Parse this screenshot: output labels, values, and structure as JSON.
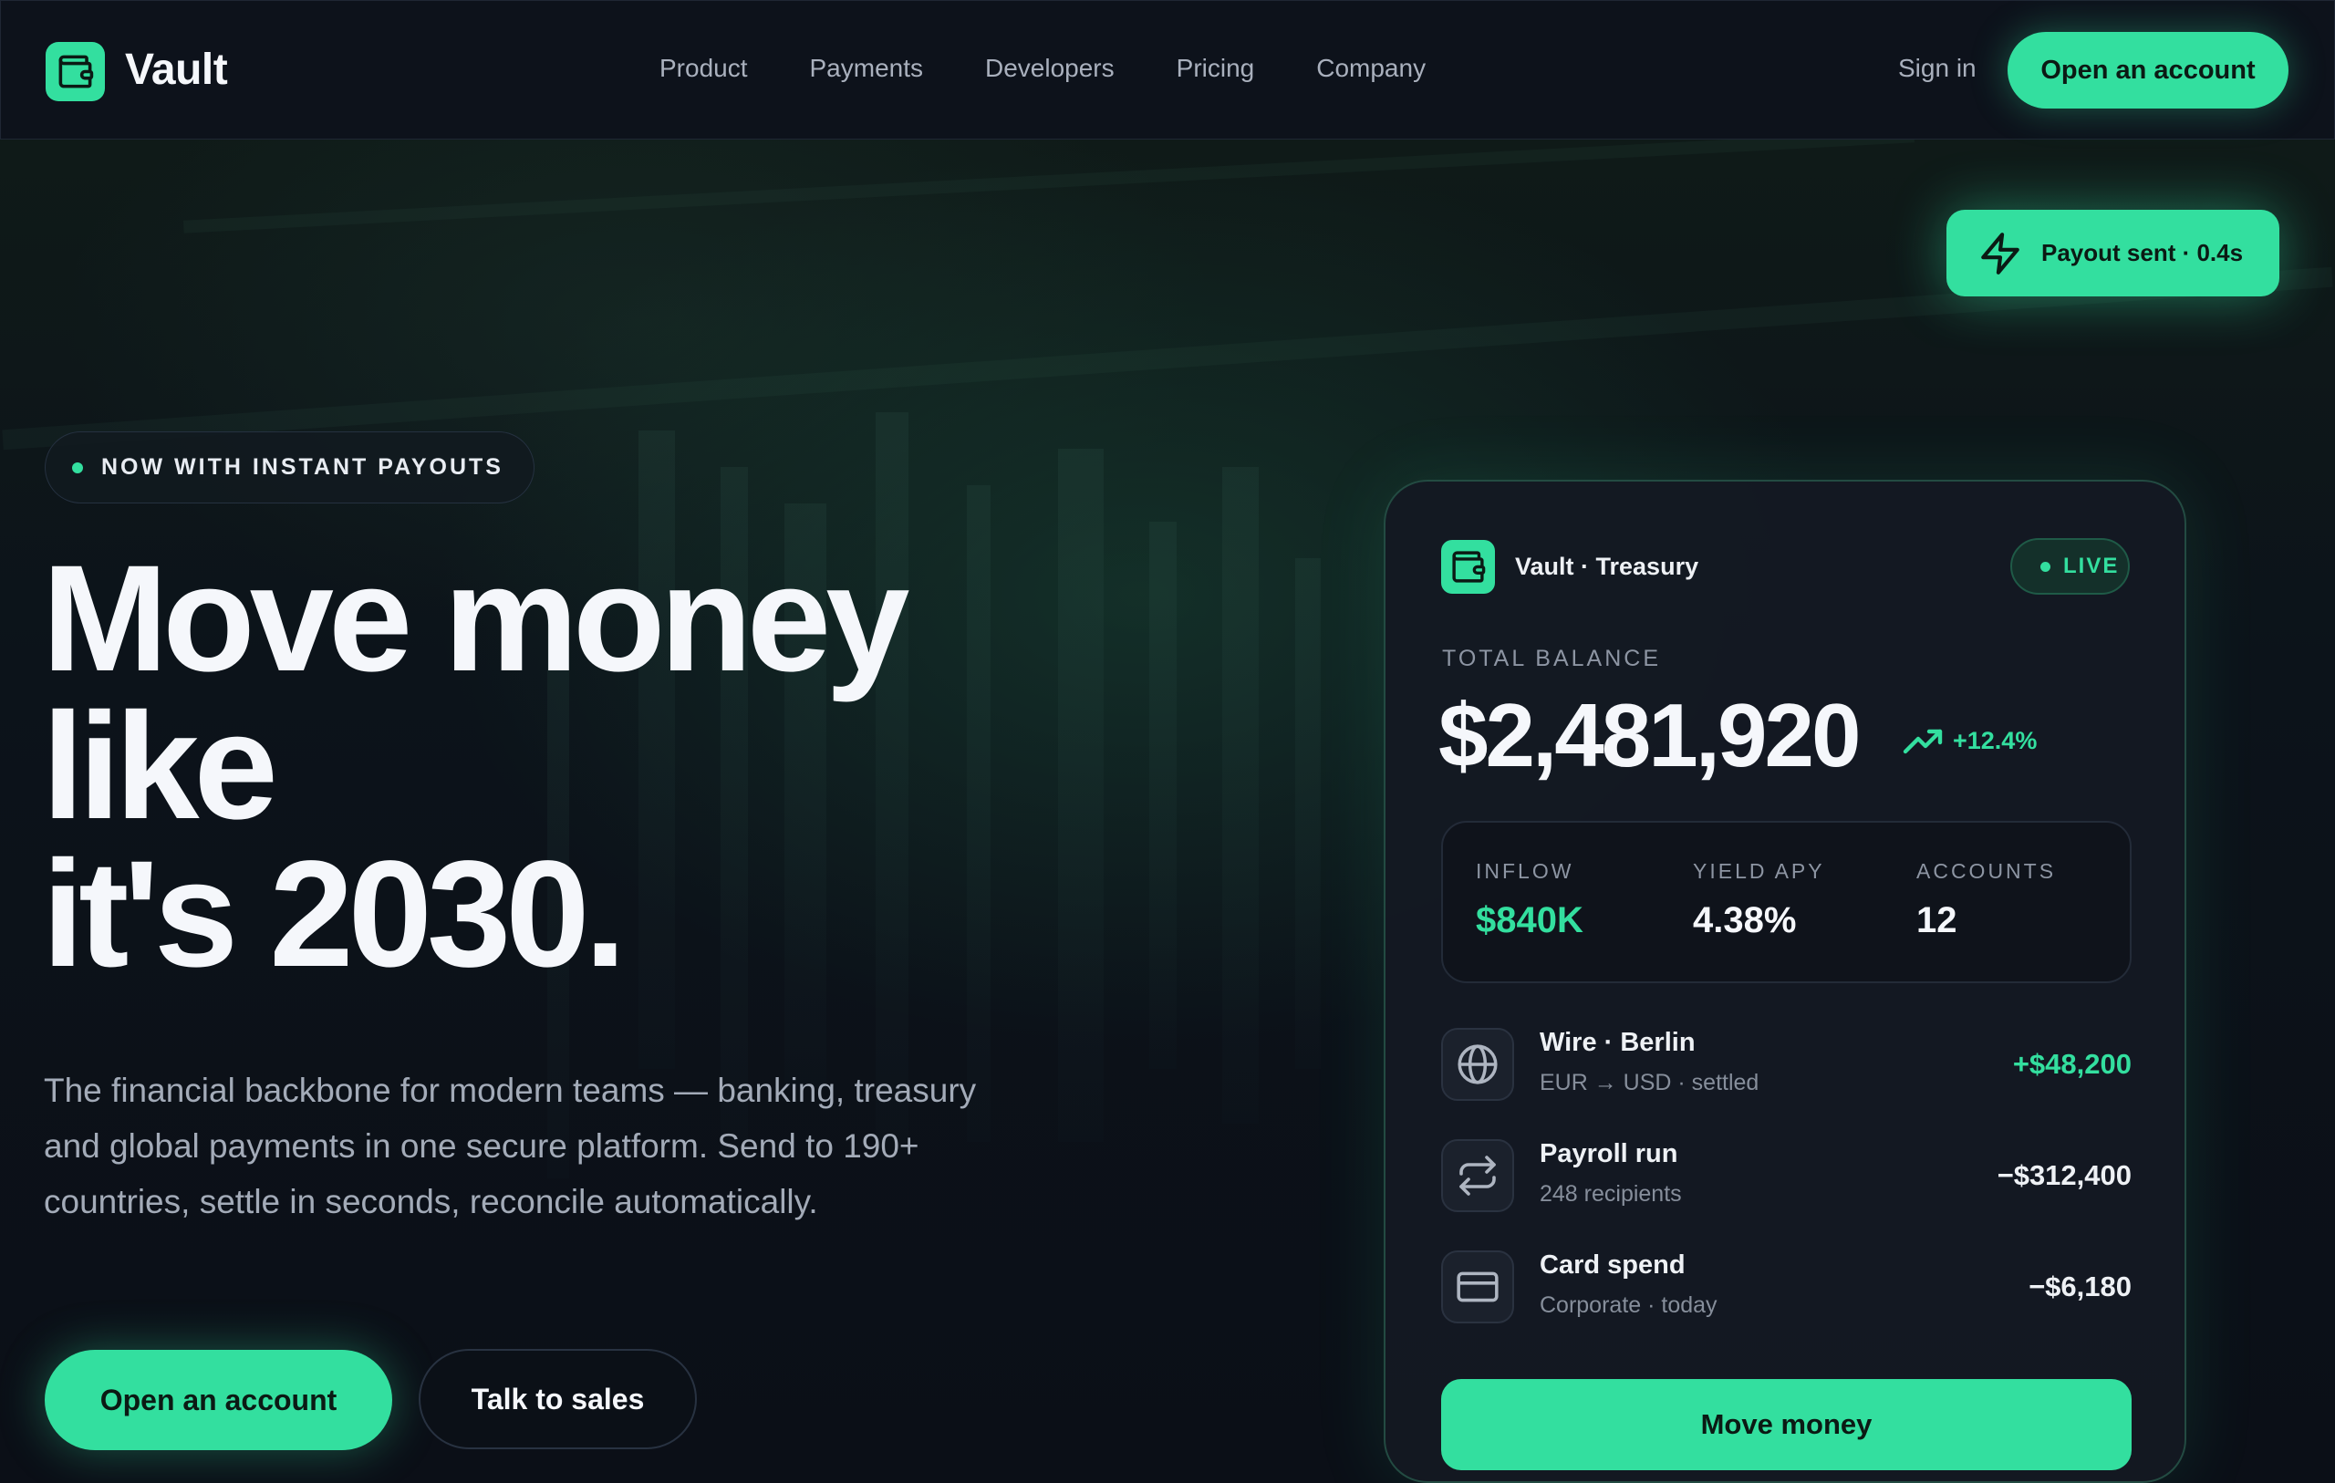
{
  "nav": {
    "brand": "Vault",
    "links": [
      "Product",
      "Payments",
      "Developers",
      "Pricing",
      "Company"
    ],
    "sign_in": "Sign in",
    "cta": "Open an account"
  },
  "toast": {
    "label": "Payout sent · 0.4s",
    "icon": "bolt-icon"
  },
  "hero": {
    "badge": "NOW WITH INSTANT PAYOUTS",
    "headline_lines": [
      "Move money",
      "like",
      "it's 2030."
    ],
    "subtitle": "The financial backbone for modern teams — banking, treasury and global payments in one secure platform. Send to 190+ countries, settle in seconds, reconcile automatically.",
    "primary_cta": "Open an account",
    "secondary_cta": "Talk to sales"
  },
  "card": {
    "title": "Vault · Treasury",
    "status": "LIVE",
    "balance_label": "TOTAL BALANCE",
    "balance": "$2,481,920",
    "change": "+12.4%",
    "stats": [
      {
        "label": "INFLOW",
        "value": "$840K",
        "accent": true
      },
      {
        "label": "YIELD APY",
        "value": "4.38%",
        "accent": false
      },
      {
        "label": "ACCOUNTS",
        "value": "12",
        "accent": false
      }
    ],
    "transactions": [
      {
        "icon": "globe-icon",
        "name": "Wire · Berlin",
        "meta": "EUR → USD · settled",
        "amount": "+$48,200",
        "positive": true
      },
      {
        "icon": "swap-icon",
        "name": "Payroll run",
        "meta": "248 recipients",
        "amount": "−$312,400",
        "positive": false
      },
      {
        "icon": "card-icon",
        "name": "Card spend",
        "meta": "Corporate · today",
        "amount": "−$6,180",
        "positive": false
      }
    ],
    "action": "Move money"
  },
  "colors": {
    "accent": "#33df9f",
    "background": "#0b0f17",
    "card": "#141922"
  }
}
